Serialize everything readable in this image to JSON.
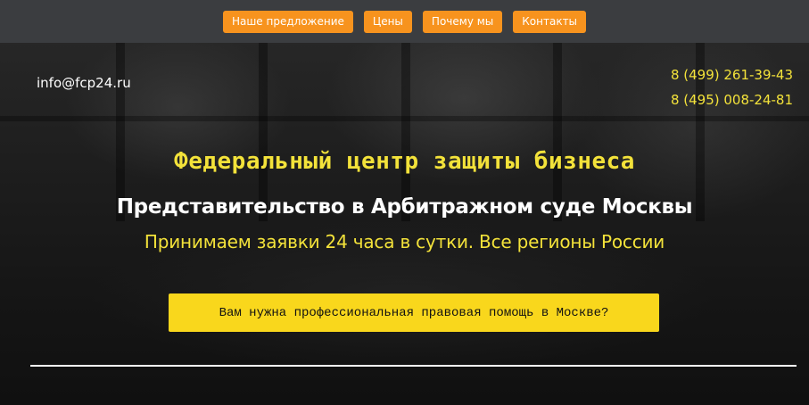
{
  "nav": {
    "items": [
      {
        "label": "Наше предложение"
      },
      {
        "label": "Цены"
      },
      {
        "label": "Почему мы"
      },
      {
        "label": "Контакты"
      }
    ]
  },
  "contacts": {
    "email": "info@fcp24.ru",
    "phones": [
      "8 (499) 261-39-43",
      "8 (495) 008-24-81"
    ]
  },
  "hero": {
    "title": "Федеральный центр защиты бизнеса",
    "subtitle": "Представительство в Арбитражном суде Москвы",
    "note": "Принимаем заявки 24 часа в сутки. Все регионы России",
    "cta_label": "Вам нужна профессиональная правовая помощь в Москве?"
  },
  "colors": {
    "nav_bg": "#3b3d40",
    "nav_button": "#f7931e",
    "accent_yellow": "#f3e23a",
    "cta_bg": "#f9d71c"
  }
}
